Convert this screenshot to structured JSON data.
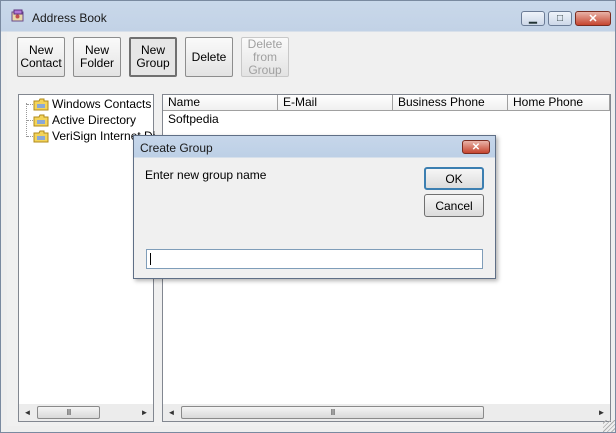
{
  "window": {
    "title": "Address Book"
  },
  "titlebar_buttons": {
    "minimize": "▁",
    "maximize": "□",
    "close": "✕"
  },
  "toolbar": [
    {
      "label": "New\nContact",
      "state": "normal"
    },
    {
      "label": "New\nFolder",
      "state": "normal"
    },
    {
      "label": "New\nGroup",
      "state": "pressed"
    },
    {
      "label": "Delete",
      "state": "normal"
    },
    {
      "label": "Delete\nfrom\nGroup",
      "state": "disabled"
    }
  ],
  "tree": {
    "items": [
      {
        "label": "Windows Contacts",
        "icon": "folder-icon"
      },
      {
        "label": "Active Directory",
        "icon": "folder-icon"
      },
      {
        "label": "VeriSign Internet Directory",
        "icon": "folder-icon"
      }
    ]
  },
  "list": {
    "columns": [
      "Name",
      "E-Mail",
      "Business Phone",
      "Home Phone"
    ],
    "rows": [
      {
        "name": "Softpedia"
      }
    ]
  },
  "scrollbar": {
    "thumb_grip": "III",
    "left_arrow": "◄",
    "right_arrow": "►"
  },
  "dialog": {
    "title": "Create Group",
    "prompt": "Enter new group name",
    "ok_label": "OK",
    "cancel_label": "Cancel",
    "input_value": ""
  },
  "colors": {
    "title_gradient_top": "#c9d8ea",
    "default_button_border": "#3c7fb1",
    "close_button": "#c6452f"
  }
}
